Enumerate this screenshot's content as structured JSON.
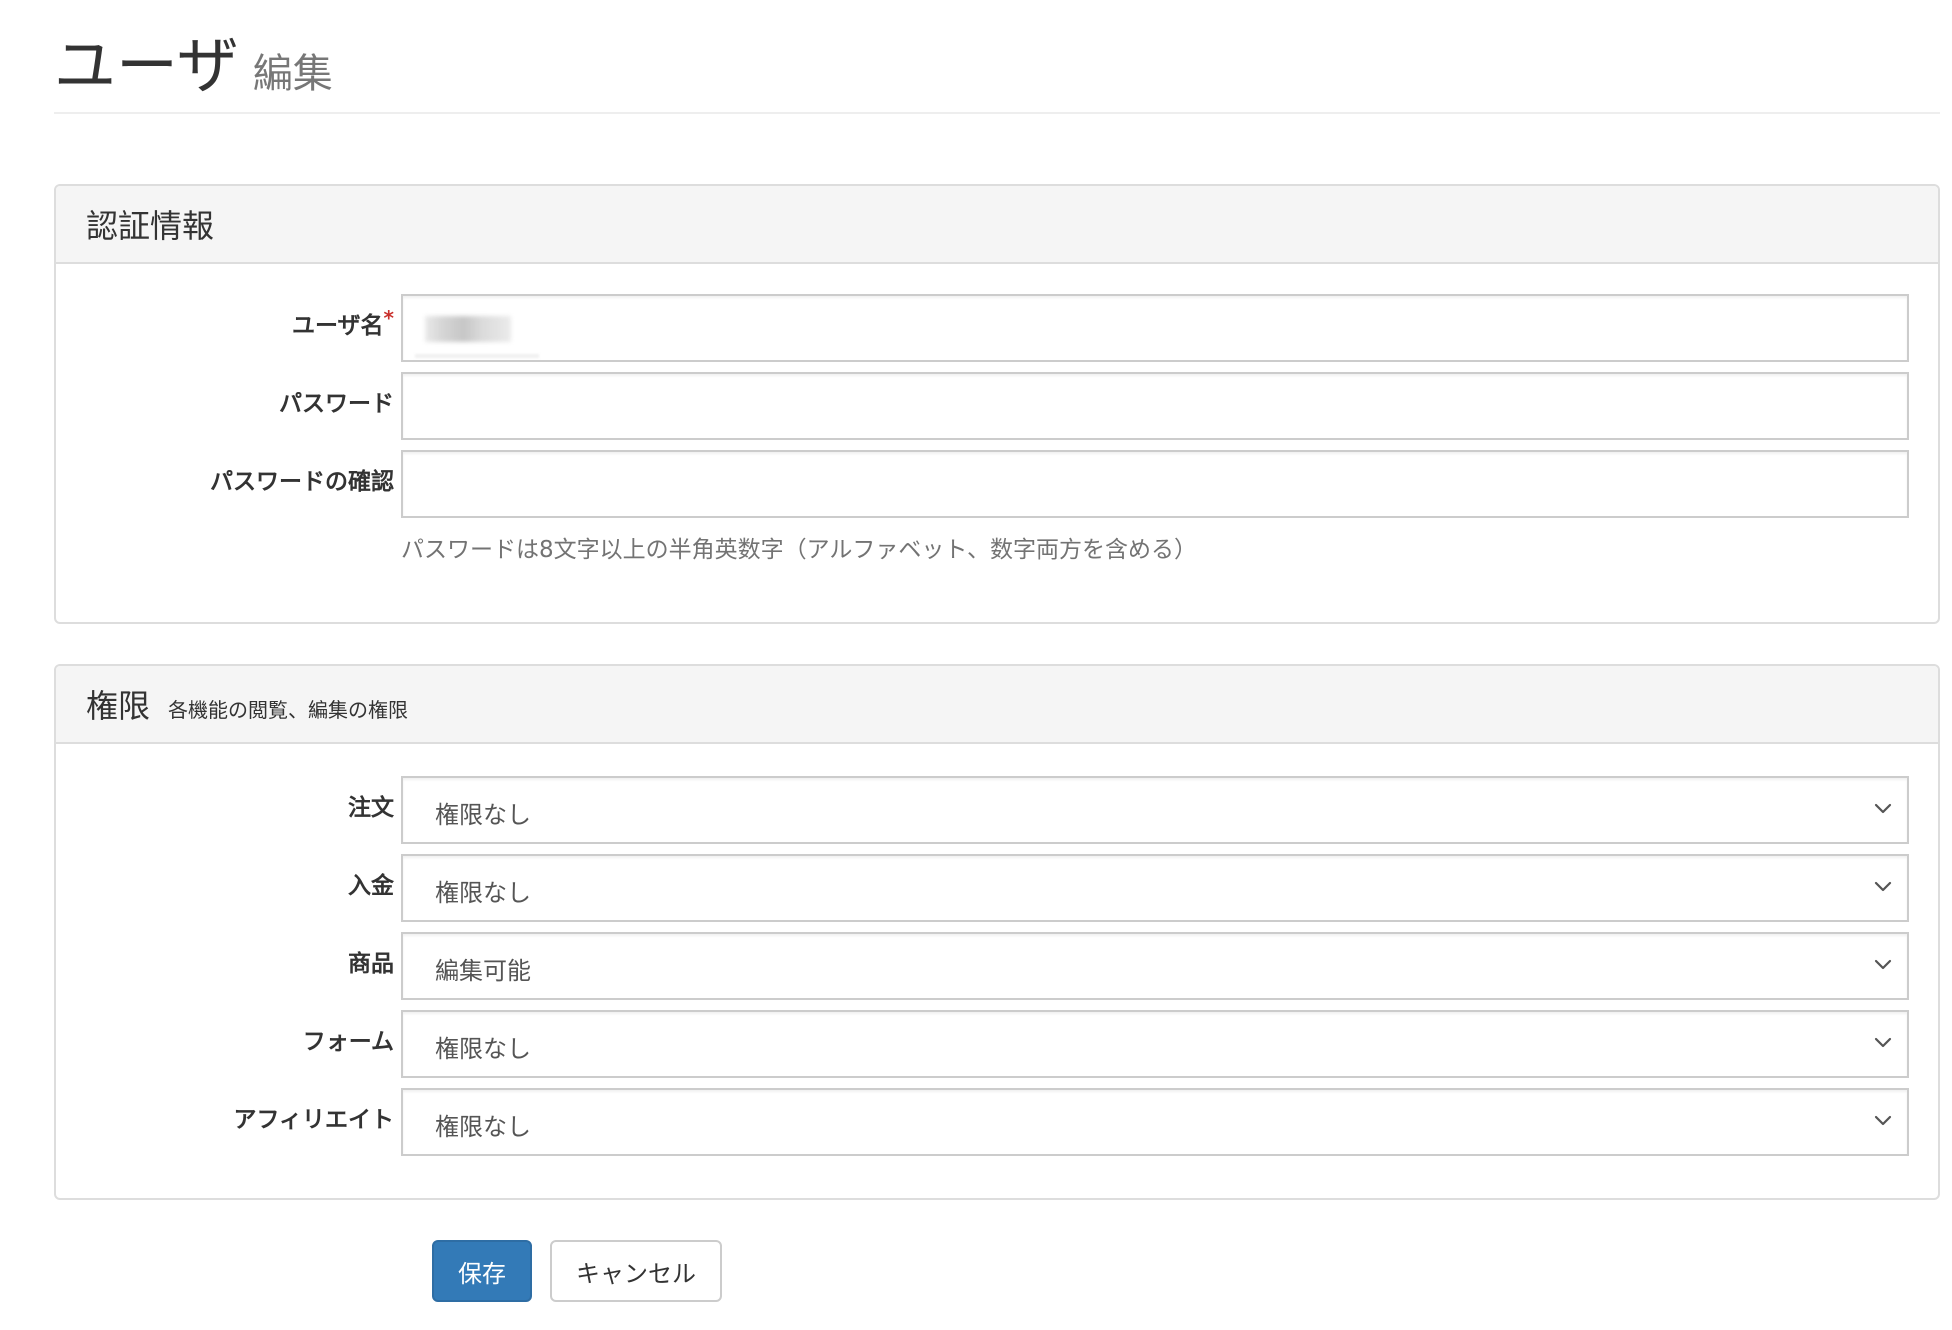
{
  "header": {
    "title": "ユーザ",
    "subtitle": "編集"
  },
  "auth_panel": {
    "title": "認証情報",
    "username": {
      "label": "ユーザ名",
      "required_mark": "*"
    },
    "password": {
      "label": "パスワード",
      "value": ""
    },
    "password_confirm": {
      "label": "パスワードの確認",
      "value": ""
    },
    "help_text": "パスワードは8文字以上の半角英数字（アルファベット、数字両方を含める）"
  },
  "permissions_panel": {
    "title": "権限",
    "subtitle": "各機能の閲覧、編集の権限",
    "rows": [
      {
        "label": "注文",
        "value": "権限なし"
      },
      {
        "label": "入金",
        "value": "権限なし"
      },
      {
        "label": "商品",
        "value": "編集可能"
      },
      {
        "label": "フォーム",
        "value": "権限なし"
      },
      {
        "label": "アフィリエイト",
        "value": "権限なし"
      }
    ]
  },
  "actions": {
    "save_label": "保存",
    "cancel_label": "キャンセル"
  },
  "icons": {
    "select_arrow": "chevron-down-icon"
  },
  "colors": {
    "primary": "#337ab7",
    "required": "#c9302c",
    "panel_heading_bg": "#f5f5f5"
  }
}
